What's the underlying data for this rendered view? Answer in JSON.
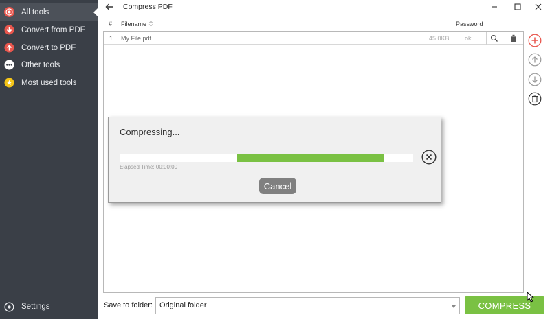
{
  "sidebar": {
    "items": [
      {
        "label": "All tools",
        "icon": "target-icon",
        "color": "#e8564d",
        "active": true
      },
      {
        "label": "Convert from PDF",
        "icon": "arrow-down-icon",
        "color": "#e8564d"
      },
      {
        "label": "Convert to PDF",
        "icon": "arrow-up-icon",
        "color": "#e8564d"
      },
      {
        "label": "Other tools",
        "icon": "more-icon",
        "color": "#ffffff"
      },
      {
        "label": "Most used tools",
        "icon": "star-icon",
        "color": "#f5c518"
      }
    ],
    "settings_label": "Settings"
  },
  "header": {
    "title": "Compress PDF"
  },
  "table": {
    "columns": [
      "#",
      "Filename",
      "Password"
    ],
    "rows": [
      {
        "num": "1",
        "filename": "My File.pdf",
        "size": "45.0KB",
        "password": "ok"
      }
    ]
  },
  "dialog": {
    "title": "Compressing...",
    "progress_start": 0.4,
    "progress_end": 0.9,
    "elapsed": "Elapsed Time: 00:00:00",
    "cancel_label": "Cancel"
  },
  "footer": {
    "save_label": "Save to folder:",
    "folder_value": "Original folder",
    "compress_label": "COMPRESS"
  },
  "colors": {
    "accent_green": "#7ac143",
    "sidebar_bg": "#3a3f47",
    "add_red": "#e8564d"
  }
}
